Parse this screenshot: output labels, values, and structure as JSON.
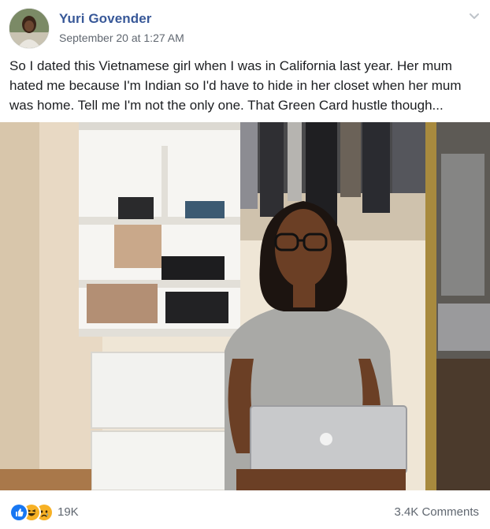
{
  "post": {
    "author": "Yuri Govender",
    "timestamp": "September 20 at 1:27 AM",
    "text": "So I dated this Vietnamese girl when I was in California last year. Her mum hated me because I'm Indian so I'd have to hide in her closet when her mum was home. Tell me I'm not the only one. That Green Card hustle though..."
  },
  "footer": {
    "reactions": [
      "like-icon",
      "haha-icon",
      "sad-icon"
    ],
    "reaction_count": "19K",
    "comments": "3.4K Comments"
  },
  "colors": {
    "author_link": "#385898",
    "secondary_text": "#606770",
    "like_blue": "#1877f2",
    "emoji_yellow": "#f7b125"
  }
}
